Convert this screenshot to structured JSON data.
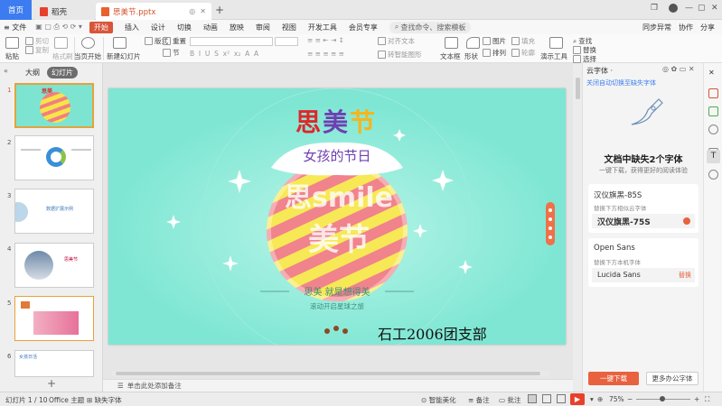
{
  "titlebar": {
    "home_tab": "首页",
    "tab1": "稻壳",
    "tab2": "思美节.pptx",
    "new_tab": "+"
  },
  "menubar": {
    "file": "≡ 文件",
    "items": [
      "开始",
      "插入",
      "设计",
      "切换",
      "动画",
      "放映",
      "审阅",
      "视图",
      "开发工具",
      "会员专享"
    ],
    "search_placeholder": "查找命令、搜索模板",
    "right": [
      "同步异常",
      "协作",
      "分享"
    ]
  },
  "ribbon": {
    "paste": "粘贴",
    "cut": "剪切",
    "copy": "复制",
    "format_painter": "格式刷",
    "from_current": "当页开始",
    "new_slide": "新建幻灯片",
    "layout": "版式",
    "reset": "重置",
    "section": "节",
    "align_text": "对齐文本",
    "convert_smartart": "转智能图形",
    "textbox": "文本框",
    "shape": "形状",
    "picture": "图片",
    "fill": "填充",
    "arrange": "排列",
    "outline": "轮廓",
    "tools": "演示工具",
    "find": "查找",
    "replace": "替换",
    "select": "选择"
  },
  "leftpanel": {
    "outline_tab": "大纲",
    "slides_tab": "幻灯片",
    "slide_numbers": [
      "1",
      "2",
      "3",
      "4",
      "5",
      "6"
    ],
    "thumb3_text": "数据扩展示例",
    "thumb4_text": "思美节",
    "thumb6_text": "女孩日活"
  },
  "slide": {
    "title_chars": [
      "思",
      "美",
      "节"
    ],
    "title_colors": [
      "#e0262a",
      "#6f3fb2",
      "#f6b51b"
    ],
    "subtitle": "女孩的节日",
    "art_line1": "思smile",
    "art_line2": "美节",
    "tagline": "思美  就是想得美",
    "tagline2": "滚动开启星球之旅",
    "org": "石工2006团支部"
  },
  "notes_placeholder": "单击此处添加备注",
  "rightpanel": {
    "header": "云字体 ·",
    "auto_switch": "关闭自动切换至缺失字体",
    "missing_title": "文档中缺失2个字体",
    "missing_sub": "一键下载，获得更好的阅读体验",
    "font1_name": "汉仪旗黑-85S",
    "font1_desc": "替换下方相似云字体",
    "font1_replace": "汉仪旗黑-75S",
    "font2_name": "Open Sans",
    "font2_desc": "替换下方本机字体",
    "font2_replace": "Lucida Sans",
    "font2_action": "替换",
    "download_btn": "一键下载",
    "more_fonts_btn": "更多办公字体"
  },
  "statusbar": {
    "slide_count": "幻灯片 1 / 10",
    "theme": "Office 主题",
    "missing_fonts": "缺失字体",
    "smart_beautify": "智能美化",
    "notes": "备注",
    "comments": "批注",
    "zoom": "75%"
  },
  "colors": {
    "accent": "#d8553a",
    "home_blue": "#3c7cf0",
    "slide_bg": "#7ee6d3",
    "download_btn": "#e8623f"
  }
}
